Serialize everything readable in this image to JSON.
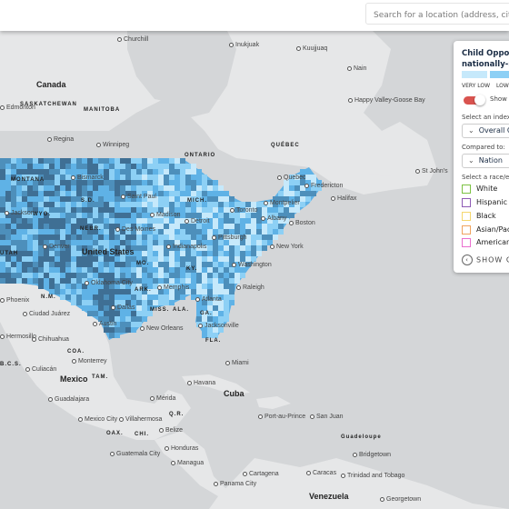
{
  "search": {
    "placeholder": "Search for a location (address, city, or state)"
  },
  "map": {
    "land_color": "#e6e7e8",
    "water_color": "#d4d6d8",
    "choropleth_colors": [
      "#c6e9fb",
      "#8dd0f5",
      "#5fb2e6",
      "#4d8fbb",
      "#3f6f94"
    ],
    "labels": {
      "countries": [
        {
          "text": "Canada"
        },
        {
          "text": "United States"
        },
        {
          "text": "Mexico"
        },
        {
          "text": "Cuba"
        },
        {
          "text": "Venezuela"
        }
      ],
      "regions": [
        {
          "text": "SASKATCHEWAN"
        },
        {
          "text": "MANITOBA"
        },
        {
          "text": "ONTARIO"
        },
        {
          "text": "QUÉBEC"
        },
        {
          "text": "MONTANA"
        },
        {
          "text": "WYO."
        },
        {
          "text": "S.D."
        },
        {
          "text": "NEBR."
        },
        {
          "text": "UTAH"
        },
        {
          "text": "MICH."
        },
        {
          "text": "MO."
        },
        {
          "text": "KY."
        },
        {
          "text": "N.M."
        },
        {
          "text": "ARK."
        },
        {
          "text": "MISS."
        },
        {
          "text": "ALA."
        },
        {
          "text": "GA."
        },
        {
          "text": "FLA."
        },
        {
          "text": "COA."
        },
        {
          "text": "B.C.S."
        },
        {
          "text": "TAM."
        },
        {
          "text": "OAX."
        },
        {
          "text": "CHI."
        },
        {
          "text": "Q.R."
        },
        {
          "text": "Guadeloupe"
        }
      ],
      "cities": [
        {
          "text": "Churchill"
        },
        {
          "text": "Inukjuak"
        },
        {
          "text": "Kuujjuaq"
        },
        {
          "text": "Nain"
        },
        {
          "text": "Happy Valley-Goose Bay"
        },
        {
          "text": "Regina"
        },
        {
          "text": "Winnipeg"
        },
        {
          "text": "Quebec"
        },
        {
          "text": "St John's"
        },
        {
          "text": "Fredericton"
        },
        {
          "text": "Halifax"
        },
        {
          "text": "Bismarck"
        },
        {
          "text": "Saint Paul"
        },
        {
          "text": "Jackson"
        },
        {
          "text": "Madison"
        },
        {
          "text": "Toronto"
        },
        {
          "text": "Montpelier"
        },
        {
          "text": "Albany"
        },
        {
          "text": "Boston"
        },
        {
          "text": "Detroit"
        },
        {
          "text": "Des Moines"
        },
        {
          "text": "Denver"
        },
        {
          "text": "Pittsburgh"
        },
        {
          "text": "New York"
        },
        {
          "text": "Indianapolis"
        },
        {
          "text": "Washington"
        },
        {
          "text": "Oklahoma City"
        },
        {
          "text": "Raleigh"
        },
        {
          "text": "Memphis"
        },
        {
          "text": "Dallas"
        },
        {
          "text": "Atlanta"
        },
        {
          "text": "Ciudad Juárez"
        },
        {
          "text": "Austin"
        },
        {
          "text": "New Orleans"
        },
        {
          "text": "Jacksonville"
        },
        {
          "text": "Hermosillo"
        },
        {
          "text": "Chihuahua"
        },
        {
          "text": "Monterrey"
        },
        {
          "text": "Miami"
        },
        {
          "text": "Culiacán"
        },
        {
          "text": "Havana"
        },
        {
          "text": "Guadalajara"
        },
        {
          "text": "Mérida"
        },
        {
          "text": "Mexico City"
        },
        {
          "text": "Villahermosa"
        },
        {
          "text": "Belize"
        },
        {
          "text": "Port-au-Prince"
        },
        {
          "text": "San Juan"
        },
        {
          "text": "Honduras"
        },
        {
          "text": "Guatemala City"
        },
        {
          "text": "Managua"
        },
        {
          "text": "Bridgetown"
        },
        {
          "text": "Cartagena"
        },
        {
          "text": "Caracas"
        },
        {
          "text": "Trinidad and Tobago"
        },
        {
          "text": "Panama City"
        },
        {
          "text": "Georgetown"
        },
        {
          "text": "Phoenix"
        },
        {
          "text": "Edmonton"
        }
      ]
    }
  },
  "panel": {
    "title_line1": "Child Opportunity Index",
    "title_line2": "nationally-normed",
    "legend": [
      {
        "label": "VERY LOW",
        "color": "#c6e9fb"
      },
      {
        "label": "LOW",
        "color": "#8dd0f5"
      }
    ],
    "toggle": {
      "label": "Show",
      "on": true,
      "color": "#d9534f"
    },
    "index_label": "Select an index:",
    "index_value": "Overall COI",
    "compare_label": "Compared to:",
    "compare_value": "Nation",
    "race_label": "Select a race/ethnicity:",
    "races": [
      {
        "label": "White",
        "color": "#7cc243"
      },
      {
        "label": "Hispanic",
        "color": "#8e5ab5"
      },
      {
        "label": "Black",
        "color": "#f5d76e"
      },
      {
        "label": "Asian/Pacific Islander",
        "color": "#f0a35e"
      },
      {
        "label": "American Indian",
        "color": "#ea6fcf"
      }
    ],
    "show_button": "SHOW CHART"
  }
}
